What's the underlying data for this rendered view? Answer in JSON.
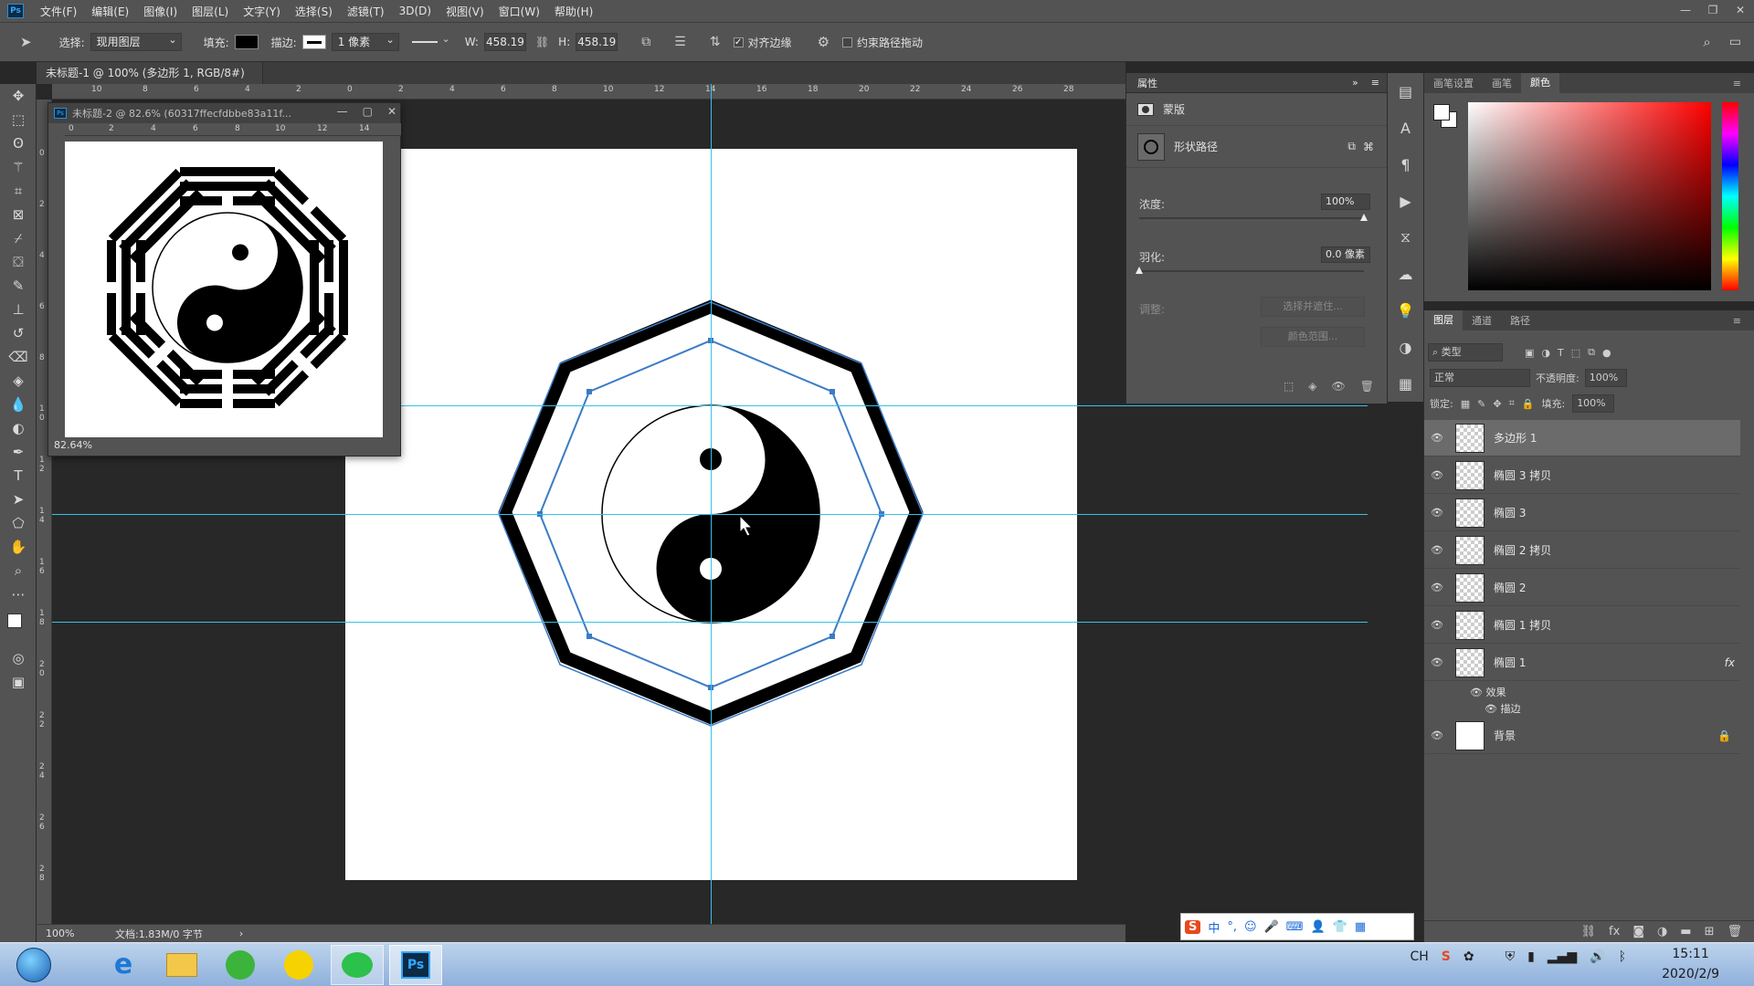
{
  "app": {
    "logo": "Ps"
  },
  "menus": [
    "文件(F)",
    "编辑(E)",
    "图像(I)",
    "图层(L)",
    "文字(Y)",
    "选择(S)",
    "滤镜(T)",
    "3D(D)",
    "视图(V)",
    "窗口(W)",
    "帮助(H)"
  ],
  "window_controls": [
    "—",
    "❐",
    "✕"
  ],
  "options": {
    "select_label": "选择:",
    "select_value": "现用图层",
    "fill_label": "填充:",
    "stroke_label": "描边:",
    "stroke_width": "1 像素",
    "w_label": "W:",
    "w_value": "458.19",
    "h_label": "H:",
    "h_value": "458.19",
    "align_edges": "对齐边缘",
    "constrain_path": "约束路径拖动"
  },
  "document": {
    "tab_title": "未标题-1 @ 100% (多边形 1, RGB/8#) *",
    "zoom": "100%",
    "doc_info": "文档:1.83M/0 字节"
  },
  "ruler_top": [
    "10",
    "8",
    "6",
    "4",
    "2",
    "0",
    "2",
    "4",
    "6",
    "8",
    "10",
    "12",
    "14",
    "16",
    "18",
    "20",
    "22",
    "24",
    "26",
    "28"
  ],
  "ruler_left": [
    "0",
    "2",
    "4",
    "6",
    "8",
    "1 0",
    "1 2",
    "1 4",
    "1 6",
    "1 8",
    "2 0",
    "2 2",
    "2 4",
    "2 6",
    "2 8"
  ],
  "float_window": {
    "title": "未标题-2 @ 82.6% (60317ffecfdbbe83a11f...",
    "zoom": "82.64%",
    "ruler": [
      "0",
      "2",
      "4",
      "6",
      "8",
      "10",
      "12",
      "14"
    ]
  },
  "properties": {
    "title": "属性",
    "mask_label": "蒙版",
    "shape_path_label": "形状路径",
    "density_label": "浓度:",
    "density_value": "100%",
    "feather_label": "羽化:",
    "feather_value": "0.0 像素",
    "adjust_label": "调整:",
    "select_mask_btn": "选择并遮住...",
    "color_range_btn": "颜色范围..."
  },
  "color_panel": {
    "tabs": [
      "画笔设置",
      "画笔",
      "颜色"
    ],
    "active": 2
  },
  "layers_panel": {
    "tabs": [
      "图层",
      "通道",
      "路径"
    ],
    "filter_kind": "类型",
    "blend_mode": "正常",
    "opacity_label": "不透明度:",
    "opacity_value": "100%",
    "lock_label": "锁定:",
    "fill_label": "填充:",
    "fill_value": "100%",
    "layers": [
      {
        "name": "多边形 1",
        "selected": true
      },
      {
        "name": "椭圆 3 拷贝"
      },
      {
        "name": "椭圆 3"
      },
      {
        "name": "椭圆 2 拷贝"
      },
      {
        "name": "椭圆 2"
      },
      {
        "name": "椭圆 1 拷贝"
      },
      {
        "name": "椭圆 1",
        "fx": "fx"
      },
      {
        "name": "背景"
      }
    ],
    "effects_label": "效果",
    "stroke_effect_label": "描边"
  },
  "ime": {
    "mode": "中"
  },
  "taskbar": {
    "tray_lang": "CH",
    "time": "15:11",
    "date": "2020/2/9"
  },
  "colors": {
    "guide": "#34c3ea",
    "path": "#3b7bc4",
    "panel": "#535353"
  }
}
